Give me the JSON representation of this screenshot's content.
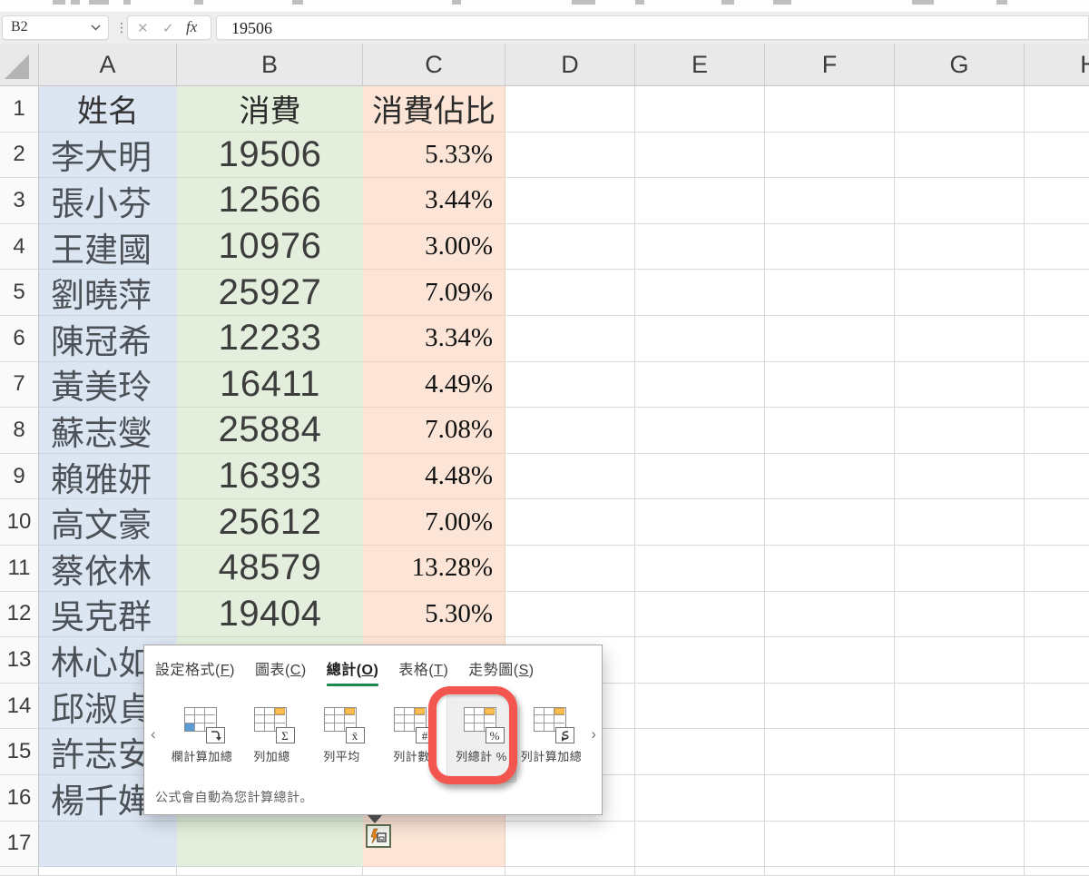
{
  "formula_bar": {
    "name_box": "B2",
    "cancel_glyph": "✕",
    "check_glyph": "✓",
    "fx_label": "fx",
    "formula": "19506"
  },
  "sheet": {
    "col_headers": [
      "A",
      "B",
      "C",
      "D",
      "E",
      "F",
      "G",
      "H"
    ],
    "table_headers": [
      "姓名",
      "消費",
      "消費佔比"
    ],
    "rows": [
      {
        "n": 2,
        "name": "李大明",
        "spend": "19506",
        "pct": "5.33%"
      },
      {
        "n": 3,
        "name": "張小芬",
        "spend": "12566",
        "pct": "3.44%"
      },
      {
        "n": 4,
        "name": "王建國",
        "spend": "10976",
        "pct": "3.00%"
      },
      {
        "n": 5,
        "name": "劉曉萍",
        "spend": "25927",
        "pct": "7.09%"
      },
      {
        "n": 6,
        "name": "陳冠希",
        "spend": "12233",
        "pct": "3.34%"
      },
      {
        "n": 7,
        "name": "黃美玲",
        "spend": "16411",
        "pct": "4.49%"
      },
      {
        "n": 8,
        "name": "蘇志燮",
        "spend": "25884",
        "pct": "7.08%"
      },
      {
        "n": 9,
        "name": "賴雅妍",
        "spend": "16393",
        "pct": "4.48%"
      },
      {
        "n": 10,
        "name": "高文豪",
        "spend": "25612",
        "pct": "7.00%"
      },
      {
        "n": 11,
        "name": "蔡依林",
        "spend": "48579",
        "pct": "13.28%"
      },
      {
        "n": 12,
        "name": "吳克群",
        "spend": "19404",
        "pct": "5.30%"
      },
      {
        "n": 13,
        "name": "林心如",
        "spend": "",
        "pct": ""
      },
      {
        "n": 14,
        "name": "邱淑貞",
        "spend": "",
        "pct": ""
      },
      {
        "n": 15,
        "name": "許志安",
        "spend": "",
        "pct": ""
      },
      {
        "n": 16,
        "name": "楊千嬅",
        "spend": "",
        "pct": ""
      },
      {
        "n": 17,
        "name": "",
        "spend": "",
        "pct": ""
      }
    ],
    "fill_colors": {
      "col_a": "#dce6f2",
      "col_b": "#e3efdc",
      "col_c": "#fce5d7"
    }
  },
  "quick_analysis": {
    "tabs": [
      {
        "label": "設定格式",
        "key": "F",
        "active": false
      },
      {
        "label": "圖表",
        "key": "C",
        "active": false
      },
      {
        "label": "總計",
        "key": "O",
        "active": true
      },
      {
        "label": "表格",
        "key": "T",
        "active": false
      },
      {
        "label": "走勢圖",
        "key": "S",
        "active": false
      }
    ],
    "items": [
      {
        "label": "欄計算加總",
        "icon": "running-total-down",
        "badge": "",
        "accent": "blue",
        "hovered": false
      },
      {
        "label": "列加總",
        "icon": "sum",
        "badge": "Σ",
        "accent": "orange",
        "hovered": false
      },
      {
        "label": "列平均",
        "icon": "average",
        "badge": "x̄",
        "accent": "orange",
        "hovered": false
      },
      {
        "label": "列計數",
        "icon": "count",
        "badge": "#",
        "accent": "orange",
        "hovered": false
      },
      {
        "label": "列總計 %",
        "icon": "percent-total",
        "badge": "%",
        "accent": "orange",
        "hovered": true
      },
      {
        "label": "列計算加總",
        "icon": "running-total-right",
        "badge": "",
        "accent": "orange",
        "hovered": false
      }
    ],
    "left_chevron": "‹",
    "right_chevron": "›",
    "footer": "公式會自動為您計算總計。",
    "active_tab_accent": "#1e8650",
    "annotation_color": "#f2564e"
  }
}
